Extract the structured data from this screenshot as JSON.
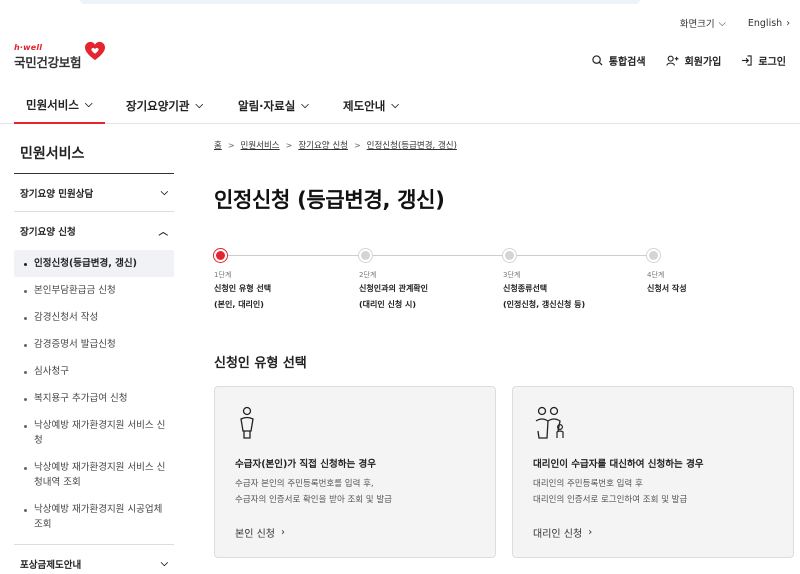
{
  "util": {
    "font_size": "화면크기",
    "language": "English"
  },
  "logo": {
    "brand": "h·well",
    "name": "국민건강보험"
  },
  "header_actions": {
    "search": "통합검색",
    "join": "회원가입",
    "login": "로그인"
  },
  "gnb": [
    "민원서비스",
    "장기요양기관",
    "알림·자료실",
    "제도안내"
  ],
  "sidebar": {
    "title": "민원서비스",
    "group1": "장기요양 민원상담",
    "group2": "장기요양 신청",
    "items": [
      "인정신청(등급변경, 갱신)",
      "본인부담환급금 신청",
      "감경신청서 작성",
      "감경증명서 발급신청",
      "심사청구",
      "복지용구 추가급여 신청",
      "낙상예방 재가환경지원 서비스 신청",
      "낙상예방 재가환경지원 서비스 신청내역 조회",
      "낙상예방 재가환경지원 시공업체 조회"
    ],
    "group3": "포상금제도안내"
  },
  "breadcrumb": [
    "홈",
    "민원서비스",
    "장기요양 신청",
    "인정신청(등급변경, 갱신)"
  ],
  "page_title": "인정신청 (등급변경, 갱신)",
  "steps": [
    {
      "num": "1단계",
      "line1": "신청인 유형 선택",
      "line2": "(본인, 대리인)"
    },
    {
      "num": "2단계",
      "line1": "신청인과의 관계확인",
      "line2": "(대리인 신청 시)"
    },
    {
      "num": "3단계",
      "line1": "신청종류선택",
      "line2": "(인정신청, 갱신신청 등)"
    },
    {
      "num": "4단계",
      "line1": "신청서 작성",
      "line2": ""
    }
  ],
  "active_step": 1,
  "section_title": "신청인 유형 선택",
  "cards": [
    {
      "title": "수급자(본인)가 직접 신청하는 경우",
      "desc1": "수급자 본인의 주민등록번호를 입력 후,",
      "desc2": "수급자의 인증서로 확인을 받아 조회 및 발급",
      "link": "본인 신청",
      "icon": "person-icon"
    },
    {
      "title": "대리인이 수급자를 대신하여 신청하는 경우",
      "desc1": "대리인의 주민등록번호 입력 후",
      "desc2": "대리인의 인증서로 로그인하여 조회 및 발급",
      "link": "대리인 신청",
      "icon": "family-icon"
    }
  ],
  "colors": {
    "accent": "#e4242f",
    "card_bg": "#f4f4f4"
  }
}
